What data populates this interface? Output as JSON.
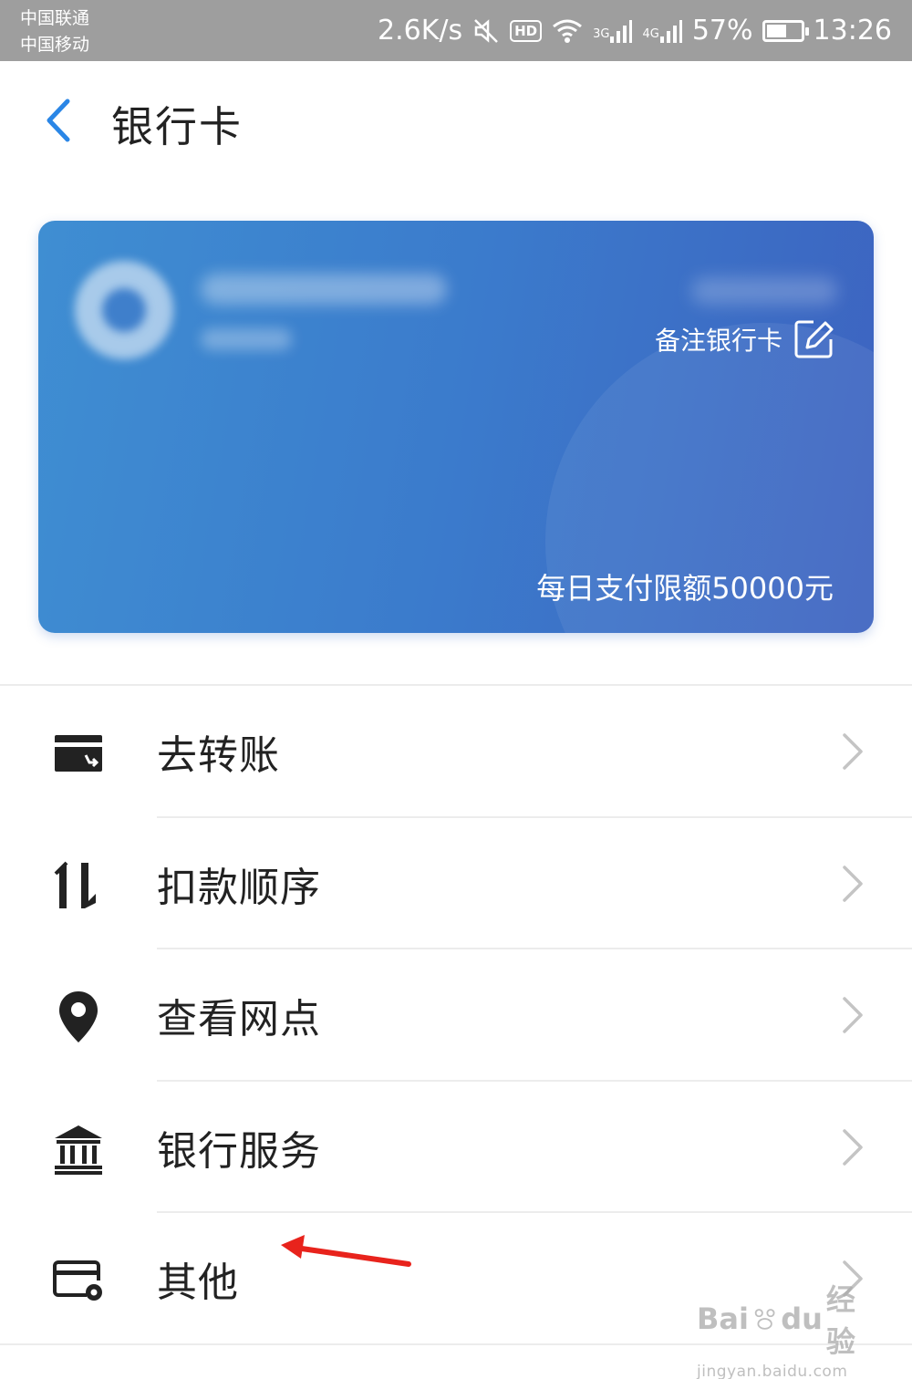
{
  "status_bar": {
    "carrier_1": "中国联通",
    "carrier_2": "中国移动",
    "speed": "2.6K/s",
    "hd_badge": "HD",
    "net_3g": "3G",
    "net_4g": "4G",
    "battery_percent": "57%",
    "battery_level": 0.57,
    "time": "13:26"
  },
  "header": {
    "title": "银行卡",
    "back_icon": "chevron-left-icon"
  },
  "card": {
    "remark_label": "备注银行卡",
    "remark_icon": "edit-icon",
    "daily_limit": "每日支付限额50000元",
    "gradient_colors": [
      "#3f8ed2",
      "#3d63c0"
    ]
  },
  "menu": {
    "items": [
      {
        "label": "去转账",
        "icon": "wallet-transfer-icon"
      },
      {
        "label": "扣款顺序",
        "icon": "sort-order-icon"
      },
      {
        "label": "查看网点",
        "icon": "location-pin-icon"
      },
      {
        "label": "银行服务",
        "icon": "bank-building-icon"
      },
      {
        "label": "其他",
        "icon": "card-settings-icon"
      }
    ]
  },
  "annotation": {
    "arrow_color": "#e8231c"
  },
  "watermark": {
    "brand": "Bai",
    "brand_suffix": "du",
    "brand_cn": "经验",
    "url": "jingyan.baidu.com"
  },
  "colors": {
    "accent_blue": "#2a86e6",
    "status_bar_bg": "#9e9e9e",
    "icon_dark": "#222222",
    "chevron": "#c4c4c4"
  }
}
